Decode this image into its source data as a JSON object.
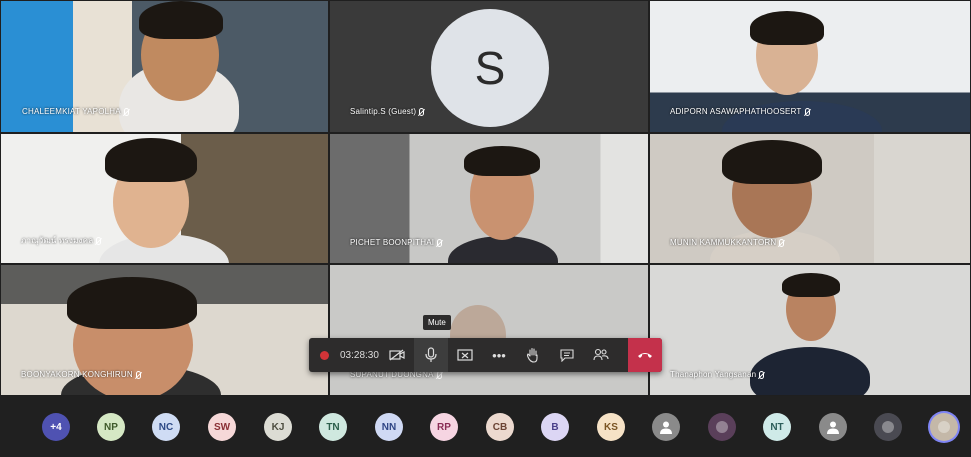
{
  "tiles": [
    {
      "name": "CHALEEMKIAT YAPOLHA"
    },
    {
      "name": "Salintip.S (Guest)",
      "avatar_letter": "S"
    },
    {
      "name": "ADIPORN ASAWAPHATHOOSERT"
    },
    {
      "name": "ภาณุวัฒน์ ทรงมงคล"
    },
    {
      "name": "PICHET BOONPITHAI"
    },
    {
      "name": "MUNIN KAMMUKKANTORN"
    },
    {
      "name": "BOONYAKORN KONGHIRUN"
    },
    {
      "name": "SUPANUT DUONGNA"
    },
    {
      "name": "Thanaphon Yangsanan"
    }
  ],
  "controls": {
    "timer": "03:28:30",
    "tooltip": "Mute",
    "record_color": "#d13438",
    "hangup_color": "#c4314b"
  },
  "participants": [
    {
      "initials": "+4",
      "bg": "#4f52b2",
      "fg": "#ffffff"
    },
    {
      "initials": "NP",
      "bg": "#d5e8c4",
      "fg": "#3f5a2a"
    },
    {
      "initials": "NC",
      "bg": "#cfdcf4",
      "fg": "#2e4a86"
    },
    {
      "initials": "SW",
      "bg": "#f6d8d8",
      "fg": "#8a2f35"
    },
    {
      "initials": "KJ",
      "bg": "#dcdcd4",
      "fg": "#4e4e40"
    },
    {
      "initials": "TN",
      "bg": "#cfe8df",
      "fg": "#2c5e4b"
    },
    {
      "initials": "NN",
      "bg": "#cfd9f4",
      "fg": "#2f4585"
    },
    {
      "initials": "RP",
      "bg": "#f6d5e2",
      "fg": "#8a2c55"
    },
    {
      "initials": "CB",
      "bg": "#ecd9cf",
      "fg": "#6b4334"
    },
    {
      "initials": "B",
      "bg": "#dcd6f4",
      "fg": "#4a3f8a"
    },
    {
      "initials": "KS",
      "bg": "#f6e2c6",
      "fg": "#7a5423"
    },
    {
      "initials": "",
      "bg": "#8a8a8a",
      "fg": "#ffffff",
      "icon": "person-icon"
    },
    {
      "initials": "",
      "bg": "#5a3f5a",
      "fg": "#ffffff",
      "icon": "photo-avatar"
    },
    {
      "initials": "NT",
      "bg": "#cfeae8",
      "fg": "#2c5e5a"
    },
    {
      "initials": "",
      "bg": "#8a8a8a",
      "fg": "#ffffff",
      "icon": "person-icon"
    },
    {
      "initials": "",
      "bg": "#4a4a52",
      "fg": "#ffffff",
      "icon": "photo-avatar"
    },
    {
      "initials": "",
      "bg": "#c4b8a8",
      "fg": "#ffffff",
      "icon": "photo-avatar"
    }
  ]
}
